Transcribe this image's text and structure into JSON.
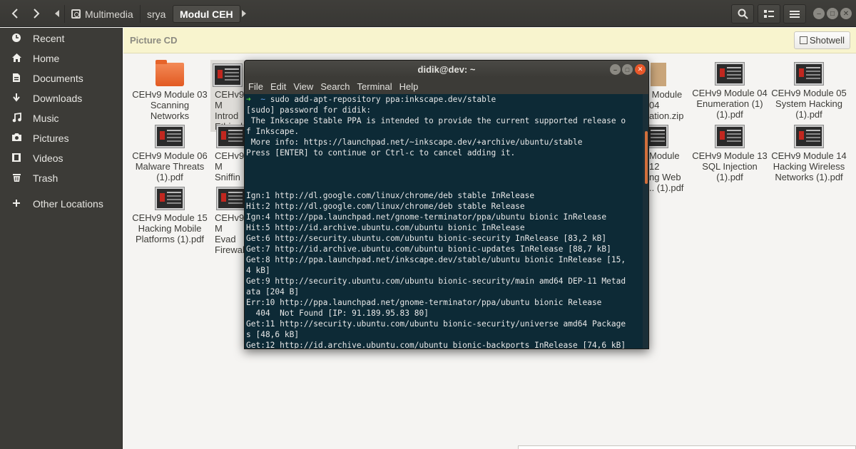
{
  "header": {
    "breadcrumbs": [
      "Multimedia",
      "srya",
      "Modul CEH"
    ]
  },
  "sidebar": {
    "items": [
      {
        "label": "Recent",
        "icon": "clock-icon"
      },
      {
        "label": "Home",
        "icon": "home-icon"
      },
      {
        "label": "Documents",
        "icon": "document-icon"
      },
      {
        "label": "Downloads",
        "icon": "download-icon"
      },
      {
        "label": "Music",
        "icon": "music-icon"
      },
      {
        "label": "Pictures",
        "icon": "camera-icon"
      },
      {
        "label": "Videos",
        "icon": "film-icon"
      },
      {
        "label": "Trash",
        "icon": "trash-icon"
      },
      {
        "label": "Other Locations",
        "icon": "plus-icon"
      }
    ]
  },
  "infobar": {
    "label": "Picture CD",
    "button": "Shotwell"
  },
  "files": [
    {
      "l1": "CEHv9 Module 03",
      "l2": "Scanning",
      "l3": "Networks",
      "type": "folder"
    },
    {
      "l1": "CEHv9 M",
      "l2": "Introd",
      "l3": "Ethical",
      "type": "pdf"
    },
    {
      "l1": "",
      "l2": "Module 04",
      "l3": "ation.zip",
      "type": "zip"
    },
    {
      "l1": "CEHv9 Module 04",
      "l2": "Enumeration (1)",
      "l3": "(1).pdf",
      "type": "pdf"
    },
    {
      "l1": "CEHv9 Module 05",
      "l2": "System Hacking",
      "l3": "(1).pdf",
      "type": "pdf"
    },
    {
      "l1": "CEHv9 Module 06",
      "l2": "Malware Threats",
      "l3": "(1).pdf",
      "type": "pdf"
    },
    {
      "l1": "CEHv9 M",
      "l2": "Sniffin",
      "l3": "",
      "type": "pdf"
    },
    {
      "l1": "Module 12",
      "l2": "ng Web",
      "l3": ".. (1).pdf",
      "type": "pdf"
    },
    {
      "l1": "CEHv9 Module 13",
      "l2": "SQL Injection",
      "l3": "(1).pdf",
      "type": "pdf"
    },
    {
      "l1": "CEHv9 Module 14",
      "l2": "Hacking Wireless",
      "l3": "Networks (1).pdf",
      "type": "pdf"
    },
    {
      "l1": "CEHv9 Module 15",
      "l2": "Hacking Mobile",
      "l3": "Platforms (1).pdf",
      "type": "pdf"
    },
    {
      "l1": "CEHv9 M",
      "l2": "Evad",
      "l3": "Firewal",
      "type": "pdf"
    }
  ],
  "terminal": {
    "title": "didik@dev: ~",
    "menu": [
      "File",
      "Edit",
      "View",
      "Search",
      "Terminal",
      "Help"
    ],
    "prompt_symbol": "➜",
    "prompt_dir": "~",
    "command": " sudo add-apt-repository ppa:inkscape.dev/stable",
    "lines": [
      "[sudo] password for didik:",
      " The Inkscape Stable PPA is intended to provide the current supported release o",
      "f Inkscape.",
      " More info: https://launchpad.net/~inkscape.dev/+archive/ubuntu/stable",
      "Press [ENTER] to continue or Ctrl-c to cancel adding it.",
      "",
      "",
      "",
      "Ign:1 http://dl.google.com/linux/chrome/deb stable InRelease",
      "Hit:2 http://dl.google.com/linux/chrome/deb stable Release",
      "Ign:4 http://ppa.launchpad.net/gnome-terminator/ppa/ubuntu bionic InRelease",
      "Hit:5 http://id.archive.ubuntu.com/ubuntu bionic InRelease",
      "Get:6 http://security.ubuntu.com/ubuntu bionic-security InRelease [83,2 kB]",
      "Get:7 http://id.archive.ubuntu.com/ubuntu bionic-updates InRelease [88,7 kB]",
      "Get:8 http://ppa.launchpad.net/inkscape.dev/stable/ubuntu bionic InRelease [15,",
      "4 kB]",
      "Get:9 http://security.ubuntu.com/ubuntu bionic-security/main amd64 DEP-11 Metad",
      "ata [204 B]",
      "Err:10 http://ppa.launchpad.net/gnome-terminator/ppa/ubuntu bionic Release",
      "  404  Not Found [IP: 91.189.95.83 80]",
      "Get:11 http://security.ubuntu.com/ubuntu bionic-security/universe amd64 Package",
      "s [48,6 kB]",
      "Get:12 http://id.archive.ubuntu.com/ubuntu bionic-backports InRelease [74,6 kB]"
    ]
  }
}
